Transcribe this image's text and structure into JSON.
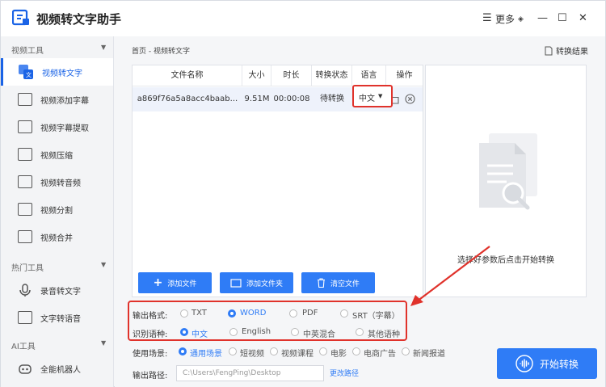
{
  "app": {
    "title": "视频转文字助手",
    "more_label": "更多"
  },
  "sidebar": {
    "sections": [
      {
        "title": "视频工具",
        "items": [
          "视频转文字",
          "视频添加字幕",
          "视频字幕提取",
          "视频压缩",
          "视频转音频",
          "视频分割",
          "视频合并"
        ]
      },
      {
        "title": "热门工具",
        "items": [
          "录音转文字",
          "文字转语音"
        ]
      },
      {
        "title": "AI工具",
        "items": [
          "全能机器人"
        ]
      }
    ],
    "active_item": "视频转文字"
  },
  "main": {
    "breadcrumb": "首页 - 视频转文字",
    "result_label": "转换结果",
    "table": {
      "headers": [
        "文件名称",
        "大小",
        "时长",
        "转换状态",
        "语言",
        "操作"
      ],
      "rows": [
        {
          "name": "a869f76a5a8acc4baab...",
          "size": "9.51M",
          "duration": "00:00:08",
          "status": "待转换",
          "language": "中文"
        }
      ]
    },
    "preview_hint": "选择好参数后点击开始转换",
    "buttons": {
      "add_file": "添加文件",
      "add_folder": "添加文件夹",
      "clear_files": "清空文件"
    },
    "options": {
      "output_format": {
        "label": "输出格式:",
        "choices": [
          "TXT",
          "WORD",
          "PDF",
          "SRT（字幕）"
        ],
        "selected": "WORD"
      },
      "language": {
        "label": "识别语种:",
        "choices": [
          "中文",
          "English",
          "中英混合",
          "其他语种"
        ],
        "selected": "中文"
      },
      "scene": {
        "label": "使用场景:",
        "choices": [
          "通用场景",
          "短视频",
          "视频课程",
          "电影",
          "电商广告",
          "新闻报道"
        ],
        "selected": "通用场景"
      },
      "output_path": {
        "label": "输出路径:",
        "value": "C:\\Users\\FengPing\\Desktop",
        "change_label": "更改路径"
      }
    },
    "start_button": "开始转换"
  },
  "colors": {
    "accent": "#2f7cf6",
    "highlight": "#e0322b",
    "active_nav": "#1a63e6"
  }
}
